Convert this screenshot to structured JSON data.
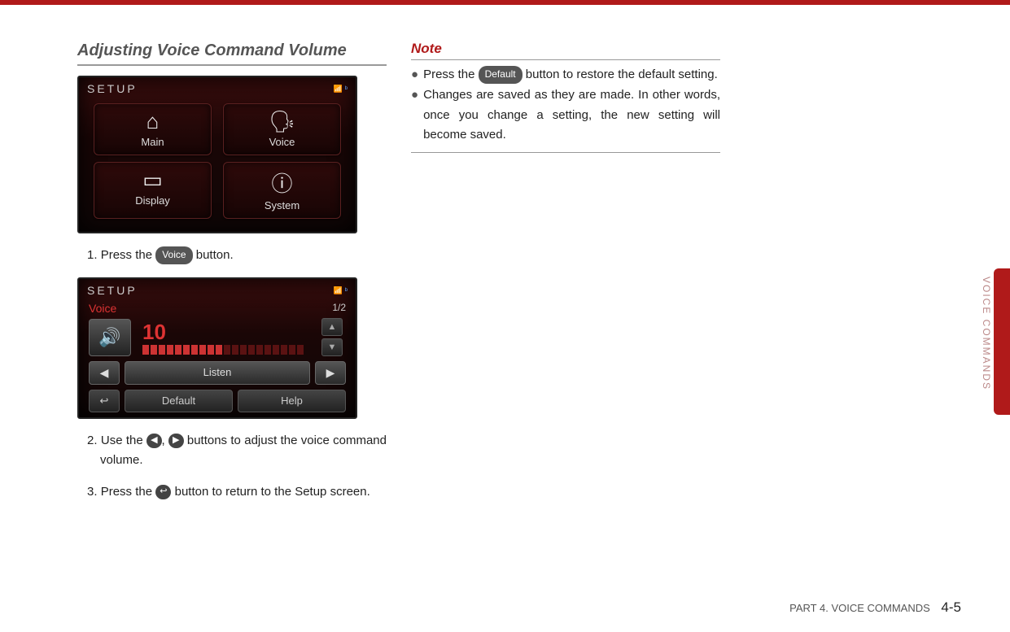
{
  "heading": "Adjusting Voice Command Volume",
  "screenshot1": {
    "title": "SETUP",
    "buttons": [
      {
        "icon": "⌂",
        "label": "Main"
      },
      {
        "icon": "🗣",
        "label": "Voice"
      },
      {
        "icon": "▭",
        "label": "Display"
      },
      {
        "icon": "ⓘ",
        "label": "System"
      }
    ]
  },
  "step1": {
    "n": "1.",
    "a": "Press the ",
    "chip": "Voice",
    "b": " button."
  },
  "screenshot2": {
    "title": "SETUP",
    "subtitle": "Voice",
    "page": "1/2",
    "volume": "10",
    "listen": "Listen",
    "default": "Default",
    "help": "Help"
  },
  "step2": {
    "n": "2.",
    "a": "Use the ",
    "c1": "◀",
    "m": ", ",
    "c2": "▶",
    "b": " buttons to adjust the voice command volume."
  },
  "step3": {
    "n": "3.",
    "a": "Press the ",
    "chip": "↩",
    "b": " button to return to the Setup screen."
  },
  "note": {
    "title": "Note",
    "items": [
      {
        "a": "Press the ",
        "chip": "Default",
        "b": " button to restore the default setting."
      },
      {
        "text": "Changes are saved as they are made. In other words, once you change a setting, the new setting will become saved."
      }
    ]
  },
  "sideText": "VOICE COMMANDS",
  "footer": {
    "part": "PART 4. VOICE COMMANDS",
    "page": "4-5"
  }
}
